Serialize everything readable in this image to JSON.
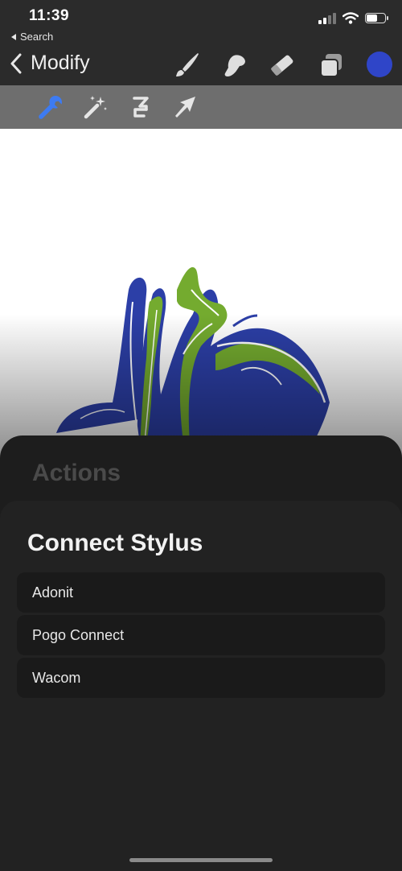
{
  "status_bar": {
    "time": "11:39",
    "back_label": "Search",
    "battery_level": 0.55
  },
  "nav": {
    "title": "Modify",
    "tools": [
      "brush-icon",
      "smudge-icon",
      "eraser-icon",
      "layers-icon"
    ],
    "color_swatch": "#2f45c8"
  },
  "sub_toolbar": {
    "tools": [
      "wrench-icon",
      "magic-wand-icon",
      "selection-icon",
      "arrow-icon"
    ],
    "active_tool": "wrench-icon",
    "active_color": "#3d7bf2"
  },
  "canvas": {
    "colors": {
      "blue": "#2c3fa7",
      "green": "#74ab2f",
      "white": "#ffffff"
    }
  },
  "actions_sheet": {
    "title": "Actions"
  },
  "stylus_sheet": {
    "title": "Connect Stylus",
    "options": [
      "Adonit",
      "Pogo Connect",
      "Wacom"
    ]
  }
}
